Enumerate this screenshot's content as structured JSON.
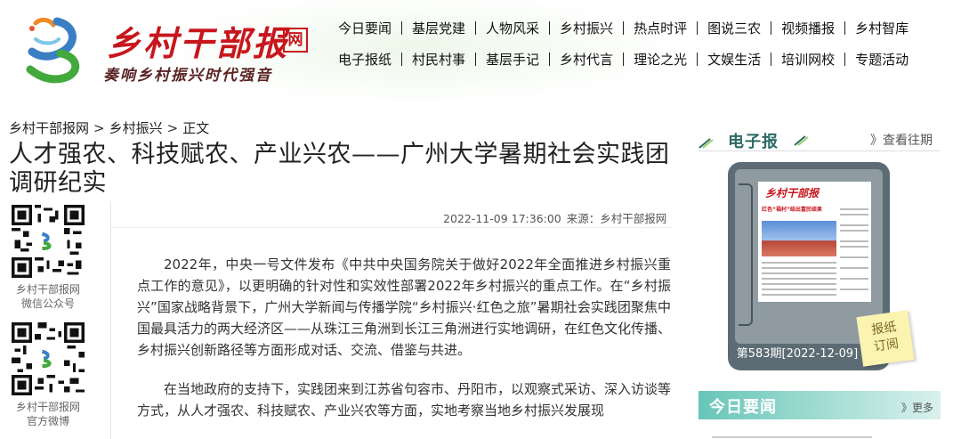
{
  "logo": {
    "title": "乡村干部报",
    "badge": "网",
    "slogan": "奏响乡村振兴时代强音"
  },
  "nav": {
    "row1": [
      "今日要闻",
      "基层党建",
      "人物风采",
      "乡村振兴",
      "热点时评",
      "图说三农",
      "视频播报",
      "乡村智库"
    ],
    "row2": [
      "电子报纸",
      "村民村事",
      "基层手记",
      "乡村代言",
      "理论之光",
      "文娱生活",
      "培训网校",
      "专题活动"
    ]
  },
  "breadcrumb": {
    "home": "乡村干部报网",
    "section": "乡村振兴",
    "current": "正文"
  },
  "article": {
    "title": "人才强农、科技赋农、产业兴农——广州大学暑期社会实践团调研纪实",
    "datetime": "2022-11-09 17:36:00",
    "source": "来源：乡村干部报网",
    "paragraphs": [
      "2022年，中央一号文件发布《中共中央国务院关于做好2022年全面推进乡村振兴重点工作的意见》，以更明确的针对性和实效性部署2022年乡村振兴的重点工作。在“乡村振兴”国家战略背景下，广州大学新闻与传播学院“乡村振兴·红色之旅”暑期社会实践团聚焦中国最具活力的两大经济区——从珠江三角洲到长江三角洲进行实地调研，在红色文化传播、乡村振兴创新路径等方面形成对话、交流、借鉴与共进。",
      "在当地政府的支持下，实践团来到江苏省句容市、丹阳市，以观察式采访、深入访谈等方式，从人才强农、科技赋农、产业兴农等方面，实地考察当地乡村振兴发展现"
    ]
  },
  "qr": {
    "wechat": [
      "乡村干部报网",
      "微信公众号"
    ],
    "weibo": [
      "乡村干部报网",
      "官方微博"
    ]
  },
  "epaper": {
    "heading": "电子报",
    "more": "》查看往期",
    "issue": "第583期[2022-12-09]",
    "subscribe": [
      "报纸",
      "订阅"
    ],
    "page_masthead": "乡村干部报",
    "page_headline": "红色“福村”结出富民硕果"
  },
  "today": {
    "heading": "今日要闻",
    "more": "》更多"
  },
  "colors": {
    "brand_red": "#c8161d",
    "teal": "#2c6a63",
    "today_bar": "#67c6b8"
  }
}
